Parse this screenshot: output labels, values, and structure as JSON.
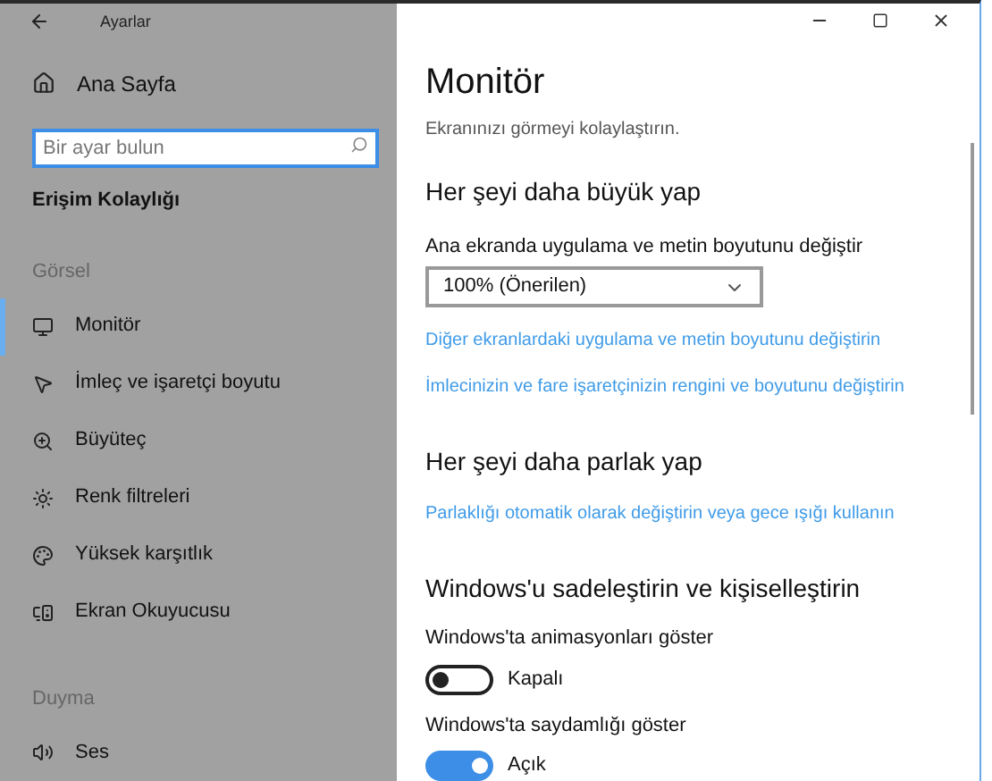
{
  "window": {
    "title": "Ayarlar"
  },
  "sidebar": {
    "home": "Ana Sayfa",
    "search": {
      "placeholder": "Bir ayar bulun"
    },
    "category": "Erişim Kolaylığı",
    "groups": [
      {
        "heading": "Görsel",
        "items": [
          {
            "label": "Monitör",
            "kind": "monitor",
            "selected": true
          },
          {
            "label": "İmleç ve işaretçi boyutu",
            "kind": "cursor",
            "selected": false
          },
          {
            "label": "Büyüteç",
            "kind": "magnifier",
            "selected": false
          },
          {
            "label": "Renk filtreleri",
            "kind": "sun",
            "selected": false
          },
          {
            "label": "Yüksek karşıtlık",
            "kind": "palette",
            "selected": false
          },
          {
            "label": "Ekran Okuyucusu",
            "kind": "narrator",
            "selected": false
          }
        ]
      },
      {
        "heading": "Duyma",
        "items": [
          {
            "label": "Ses",
            "kind": "speaker",
            "selected": false
          }
        ]
      }
    ]
  },
  "content": {
    "title": "Monitör",
    "subtitle": "Ekranınızı görmeyi kolaylaştırın.",
    "sections": [
      {
        "heading": "Her şeyi daha büyük yap",
        "rows": [
          {
            "kind": "dropdown",
            "label": "Ana ekranda uygulama ve metin boyutunu değiştir",
            "value": "100% (Önerilen)"
          },
          {
            "kind": "link",
            "text": "Diğer ekranlardaki uygulama ve metin boyutunu değiştirin"
          },
          {
            "kind": "link",
            "text": "İmlecinizin ve fare işaretçinizin rengini ve boyutunu değiştirin"
          }
        ]
      },
      {
        "heading": "Her şeyi daha parlak yap",
        "rows": [
          {
            "kind": "link",
            "text": "Parlaklığı otomatik olarak değiştirin veya gece ışığı kullanın"
          }
        ]
      },
      {
        "heading": "Windows'u sadeleştirin ve kişiselleştirin",
        "rows": [
          {
            "kind": "toggle",
            "label": "Windows'ta animasyonları göster",
            "on": false,
            "state_text": "Kapalı"
          },
          {
            "kind": "toggle",
            "label": "Windows'ta saydamlığı göster",
            "on": true,
            "state_text": "Açık"
          }
        ]
      }
    ]
  }
}
